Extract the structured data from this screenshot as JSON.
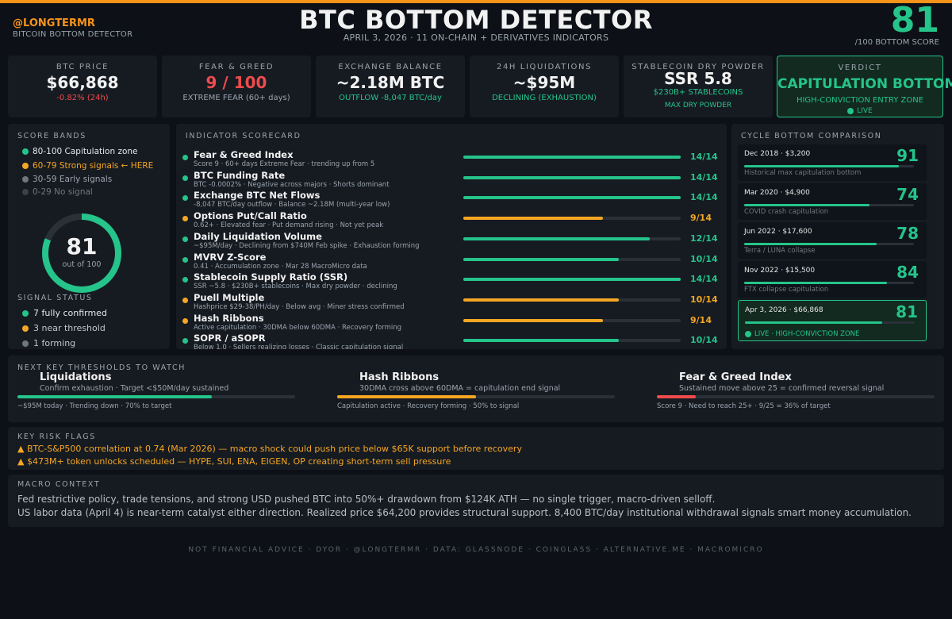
{
  "header": {
    "handle": "@LONGTERMR",
    "subhandle": "BITCOIN BOTTOM DETECTOR",
    "title": "BTC BOTTOM DETECTOR",
    "subtitle": "APRIL 3, 2026 · 11 ON-CHAIN + DERIVATIVES INDICATORS",
    "score": "81",
    "score_label": "/100 BOTTOM SCORE"
  },
  "stats": [
    {
      "label": "BTC PRICE",
      "value": "$66,868",
      "sub": "-0.82% (24h)"
    },
    {
      "label": "FEAR & GREED",
      "value": "9 / 100",
      "sub": "EXTREME FEAR (60+ days)"
    },
    {
      "label": "EXCHANGE BALANCE",
      "value": "~2.18M BTC",
      "sub": "OUTFLOW -8,047 BTC/day"
    },
    {
      "label": "24H LIQUIDATIONS",
      "value": "~$95M",
      "sub": "DECLINING (EXHAUSTION)"
    },
    {
      "label": "STABLECOIN DRY POWDER",
      "value": "SSR 5.8",
      "sub": "$230B+ STABLECOINS",
      "sub2": "MAX DRY POWDER"
    }
  ],
  "verdict": {
    "label": "VERDICT",
    "value": "CAPITULATION BOTTOM",
    "sub": "HIGH-CONVICTION ENTRY ZONE",
    "live": "LIVE"
  },
  "score_bands": {
    "title": "SCORE BANDS",
    "bands": [
      {
        "label": "80-100 Capitulation zone",
        "color": "#25c48a"
      },
      {
        "label": "60-79 Strong signals ← HERE",
        "color": "#f5a623"
      },
      {
        "label": "30-59 Early signals",
        "color": "#6e7781"
      },
      {
        "label": "0-29 No signal",
        "color": "#3a4048"
      }
    ],
    "gauge_value": "81",
    "gauge_sub": "out of 100",
    "gauge_fraction": 0.81
  },
  "signal_status": {
    "title": "SIGNAL STATUS",
    "items": [
      {
        "label": "7 fully confirmed",
        "color": "#25c48a"
      },
      {
        "label": "3 near threshold",
        "color": "#f5a623"
      },
      {
        "label": "1 forming",
        "color": "#6e7781"
      }
    ]
  },
  "scorecard": {
    "title": "INDICATOR SCORECARD",
    "indicators": [
      {
        "name": "Fear & Greed Index",
        "desc": "Score 9 · 60+ days Extreme Fear · trending up from 5",
        "score": "14/14",
        "fraction": 1.0,
        "color": "#25c48a"
      },
      {
        "name": "BTC Funding Rate",
        "desc": "BTC -0.0002% · Negative across majors · Shorts dominant",
        "score": "14/14",
        "fraction": 1.0,
        "color": "#25c48a"
      },
      {
        "name": "Exchange BTC Net Flows",
        "desc": "-8,047 BTC/day outflow · Balance ~2.18M (multi-year low)",
        "score": "14/14",
        "fraction": 1.0,
        "color": "#25c48a"
      },
      {
        "name": "Options Put/Call Ratio",
        "desc": "0.62+ · Elevated fear · Put demand rising · Not yet peak",
        "score": "9/14",
        "fraction": 0.643,
        "color": "#f5a623"
      },
      {
        "name": "Daily Liquidation Volume",
        "desc": "~$95M/day · Declining from $740M Feb spike · Exhaustion forming",
        "score": "12/14",
        "fraction": 0.857,
        "color": "#25c48a"
      },
      {
        "name": "MVRV Z-Score",
        "desc": "0.41 · Accumulation zone · Mar 28 MacroMicro data",
        "score": "10/14",
        "fraction": 0.714,
        "color": "#25c48a"
      },
      {
        "name": "Stablecoin Supply Ratio (SSR)",
        "desc": "SSR ~5.8 · $230B+ stablecoins · Max dry powder · declining",
        "score": "14/14",
        "fraction": 1.0,
        "color": "#25c48a"
      },
      {
        "name": "Puell Multiple",
        "desc": "Hashprice $29-38/PH/day · Below avg · Miner stress confirmed",
        "score": "10/14",
        "fraction": 0.714,
        "color": "#f5a623"
      },
      {
        "name": "Hash Ribbons",
        "desc": "Active capitulation · 30DMA below 60DMA · Recovery forming",
        "score": "9/14",
        "fraction": 0.643,
        "color": "#f5a623"
      },
      {
        "name": "SOPR / aSOPR",
        "desc": "Below 1.0 · Sellers realizing losses · Classic capitulation signal",
        "score": "10/14",
        "fraction": 0.714,
        "color": "#25c48a"
      }
    ]
  },
  "cycle": {
    "title": "CYCLE BOTTOM COMPARISON",
    "items": [
      {
        "date": "Dec 2018 · $3,200",
        "name": "Historical max capitulation bottom",
        "score": "91",
        "fraction": 0.91
      },
      {
        "date": "Mar 2020 · $4,900",
        "name": "COVID crash capitulation",
        "score": "74",
        "fraction": 0.74
      },
      {
        "date": "Jun 2022 · $17,600",
        "name": "Terra / LUNA collapse",
        "score": "78",
        "fraction": 0.78
      },
      {
        "date": "Nov 2022 · $15,500",
        "name": "FTX collapse capitulation",
        "score": "84",
        "fraction": 0.84
      }
    ],
    "current": {
      "date": "Apr 3, 2026 · $66,868",
      "name": "LIVE · HIGH-CONVICTION ZONE",
      "score": "81",
      "fraction": 0.81
    }
  },
  "thresholds": {
    "title": "NEXT KEY THRESHOLDS TO WATCH",
    "items": [
      {
        "name": "Liquidations",
        "desc": "Confirm exhaustion · Target <$50M/day sustained",
        "progress": "~$95M today · Trending down · 70% to target",
        "fraction": 0.7,
        "color": "#25c48a"
      },
      {
        "name": "Hash Ribbons",
        "desc": "30DMA cross above 60DMA = capitulation end signal",
        "progress": "Capitulation active · Recovery forming · 50% to signal",
        "fraction": 0.5,
        "color": "#f5a623"
      },
      {
        "name": "Fear & Greed Index",
        "desc": "Sustained move above 25 = confirmed reversal signal",
        "progress": "Score 9 · Need to reach 25+ · 9/25 = 36% of target",
        "fraction": 0.14,
        "color": "#f04b4b"
      }
    ]
  },
  "risks": {
    "title": "KEY RISK FLAGS",
    "items": [
      "▲ BTC-S&P500 correlation at 0.74 (Mar 2026) — macro shock could push price below $65K support before recovery",
      "▲ $473M+ token unlocks scheduled — HYPE, SUI, ENA, EIGEN, OP creating short-term sell pressure"
    ]
  },
  "macro": {
    "title": "MACRO CONTEXT",
    "lines": [
      "Fed restrictive policy, trade tensions, and strong USD pushed BTC into 50%+ drawdown from $124K ATH — no single trigger, macro-driven selloff.",
      "US labor data (April 4) is near-term catalyst either direction. Realized price $64,200 provides structural support. 8,400 BTC/day institutional withdrawal signals smart money accumulation."
    ]
  },
  "footer": "NOT FINANCIAL ADVICE · DYOR · @LONGTERMR · DATA: GLASSNODE · COINGLASS · ALTERNATIVE.ME · MACROMICRO"
}
